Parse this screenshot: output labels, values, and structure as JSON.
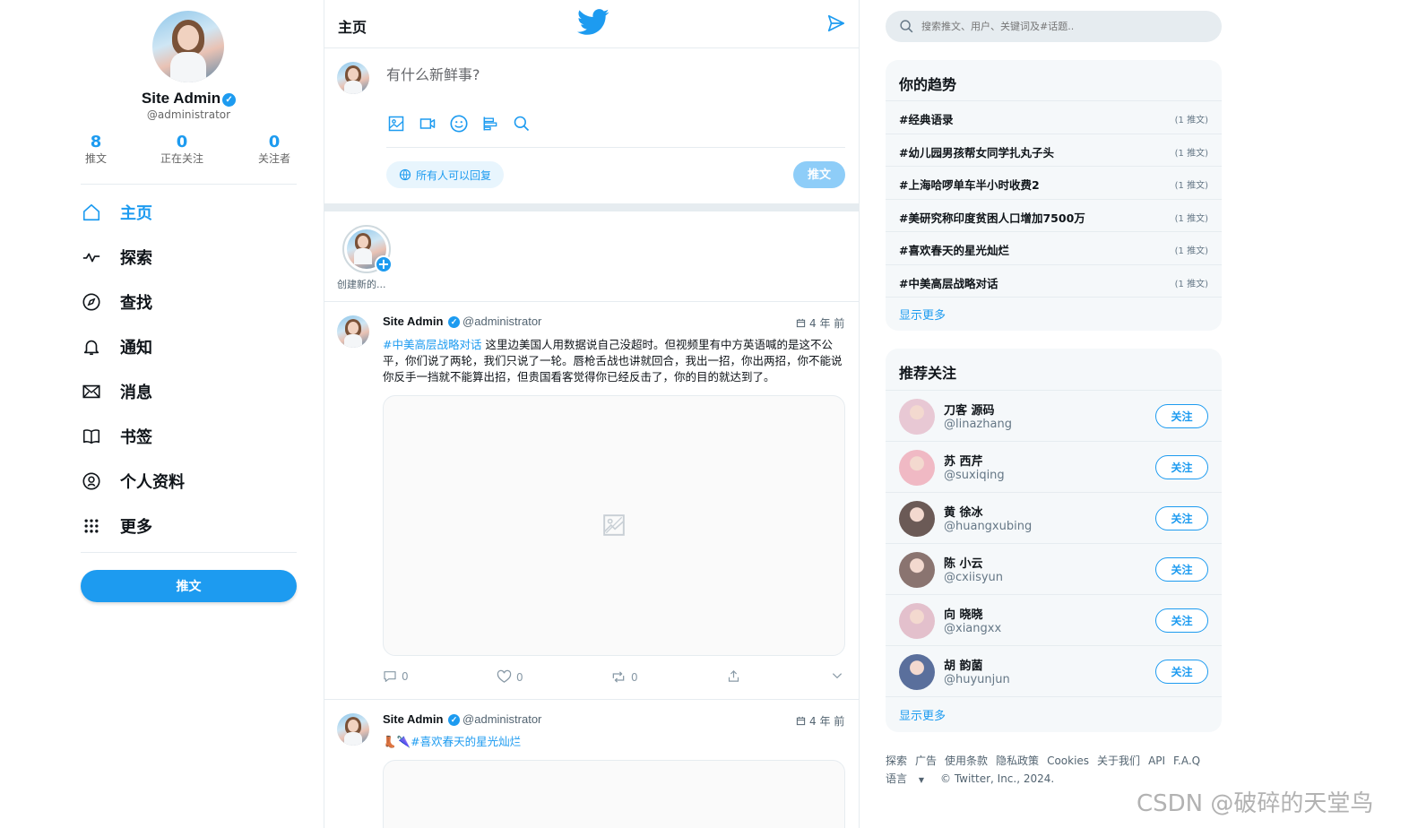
{
  "profile": {
    "name": "Site Admin",
    "handle": "@administrator",
    "stats": [
      {
        "value": "8",
        "label": "推文"
      },
      {
        "value": "0",
        "label": "正在关注"
      },
      {
        "value": "0",
        "label": "关注者"
      }
    ]
  },
  "nav": [
    {
      "label": "主页",
      "icon": "home-icon",
      "active": true
    },
    {
      "label": "探索",
      "icon": "activity-icon",
      "active": false
    },
    {
      "label": "查找",
      "icon": "compass-icon",
      "active": false
    },
    {
      "label": "通知",
      "icon": "bell-icon",
      "active": false
    },
    {
      "label": "消息",
      "icon": "envelope-icon",
      "active": false
    },
    {
      "label": "书签",
      "icon": "book-icon",
      "active": false
    },
    {
      "label": "个人资料",
      "icon": "at-icon",
      "active": false
    },
    {
      "label": "更多",
      "icon": "grid-icon",
      "active": false
    }
  ],
  "sidebar_tweet_label": "推文",
  "header": {
    "title": "主页"
  },
  "compose": {
    "placeholder": "有什么新鲜事?",
    "reply_setting": "所有人可以回复",
    "tweet_label": "推文"
  },
  "story": {
    "label": "创建新的..."
  },
  "posts": [
    {
      "name": "Site Admin",
      "handle": "@administrator",
      "time": "4 年 前",
      "hashtag": "#中美高层战略对话",
      "text": " 这里边美国人用数据说自己没超时。但视频里有中方英语喊的是这不公平，你们说了两轮，我们只说了一轮。唇枪舌战也讲就回合，我出一招，你出两招，你不能说你反手一挡就不能算出招，但贵国看客觉得你已经反击了，你的目的就达到了。",
      "actions": {
        "reply": "0",
        "like": "0",
        "retweet": "0"
      }
    },
    {
      "name": "Site Admin",
      "handle": "@administrator",
      "time": "4 年 前",
      "hashtag": "#喜欢春天的星光灿烂",
      "emoji": "👢🌂"
    }
  ],
  "search": {
    "placeholder": "搜索推文、用户、关键词及#话题.."
  },
  "trends": {
    "title": "你的趋势",
    "items": [
      {
        "tag": "#经典语录",
        "count": "(1 推文)"
      },
      {
        "tag": "#幼儿园男孩帮女同学扎丸子头",
        "count": "(1 推文)"
      },
      {
        "tag": "#上海哈啰单车半小时收费2",
        "count": "(1 推文)"
      },
      {
        "tag": "#美研究称印度贫困人口增加7500万",
        "count": "(1 推文)"
      },
      {
        "tag": "#喜欢春天的星光灿烂",
        "count": "(1 推文)"
      },
      {
        "tag": "#中美高层战略对话",
        "count": "(1 推文)"
      }
    ],
    "show_more": "显示更多"
  },
  "recommend": {
    "title": "推荐关注",
    "items": [
      {
        "name": "刀客 源码",
        "handle": "@linazhang",
        "follow": "关注",
        "color": "#e8c8d4"
      },
      {
        "name": "苏 西芹",
        "handle": "@suxiqing",
        "follow": "关注",
        "color": "#f0b9c4"
      },
      {
        "name": "黄 徐冰",
        "handle": "@huangxubing",
        "follow": "关注",
        "color": "#6b5a56"
      },
      {
        "name": "陈 小云",
        "handle": "@cxiisyun",
        "follow": "关注",
        "color": "#8a7470"
      },
      {
        "name": "向 晓晓",
        "handle": "@xiangxx",
        "follow": "关注",
        "color": "#e3c0cc"
      },
      {
        "name": "胡 韵菌",
        "handle": "@huyunjun",
        "follow": "关注",
        "color": "#5a6f9c"
      }
    ],
    "show_more": "显示更多"
  },
  "footer": {
    "links": [
      "探索",
      "广告",
      "使用条款",
      "隐私政策",
      "Cookies",
      "关于我们",
      "API",
      "F.A.Q"
    ],
    "language": "语言",
    "copyright": "© Twitter, Inc., 2024."
  },
  "watermark": "CSDN @破碎的天堂鸟",
  "colors": {
    "accent": "#1d9bf0",
    "border": "#e6ecf0",
    "panel": "#f5f8fa"
  }
}
